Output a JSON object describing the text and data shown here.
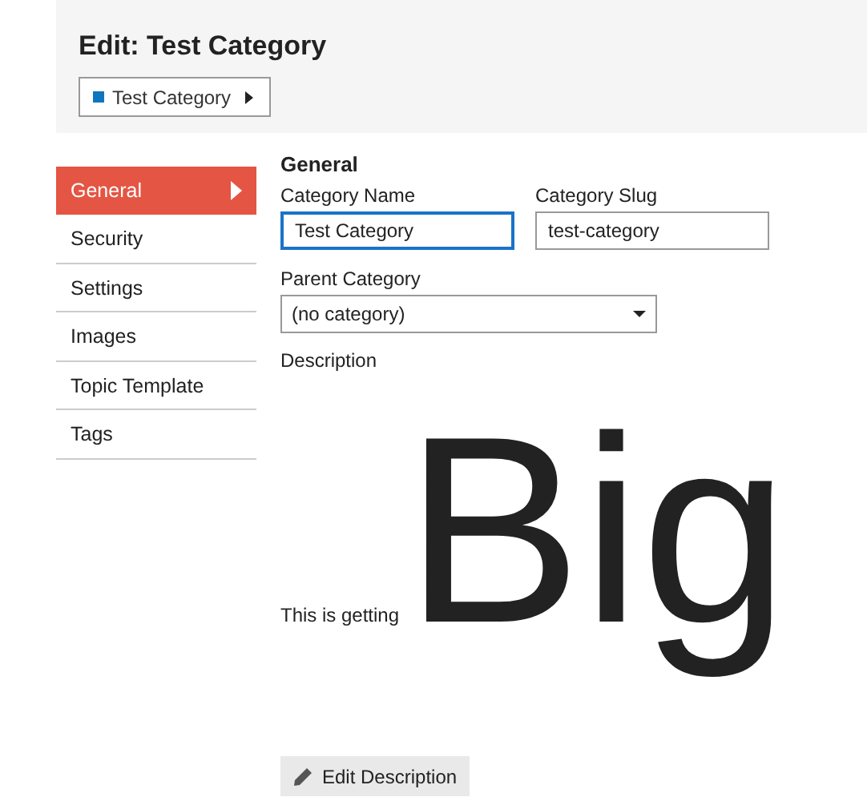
{
  "header": {
    "title": "Edit: Test Category",
    "breadcrumb": {
      "label": "Test Category",
      "color": "#0e76bd"
    }
  },
  "sidebar": {
    "items": [
      {
        "label": "General",
        "selected": true
      },
      {
        "label": "Security",
        "selected": false
      },
      {
        "label": "Settings",
        "selected": false
      },
      {
        "label": "Images",
        "selected": false
      },
      {
        "label": "Topic Template",
        "selected": false
      },
      {
        "label": "Tags",
        "selected": false
      }
    ]
  },
  "form": {
    "heading": "General",
    "name_label": "Category Name",
    "name_value": "Test Category",
    "slug_label": "Category Slug",
    "slug_value": "test-category",
    "parent_label": "Parent Category",
    "parent_value": "(no category)",
    "description_label": "Description",
    "description": {
      "text": "This is getting",
      "big_text": "Big"
    },
    "edit_button": "Edit Description"
  }
}
